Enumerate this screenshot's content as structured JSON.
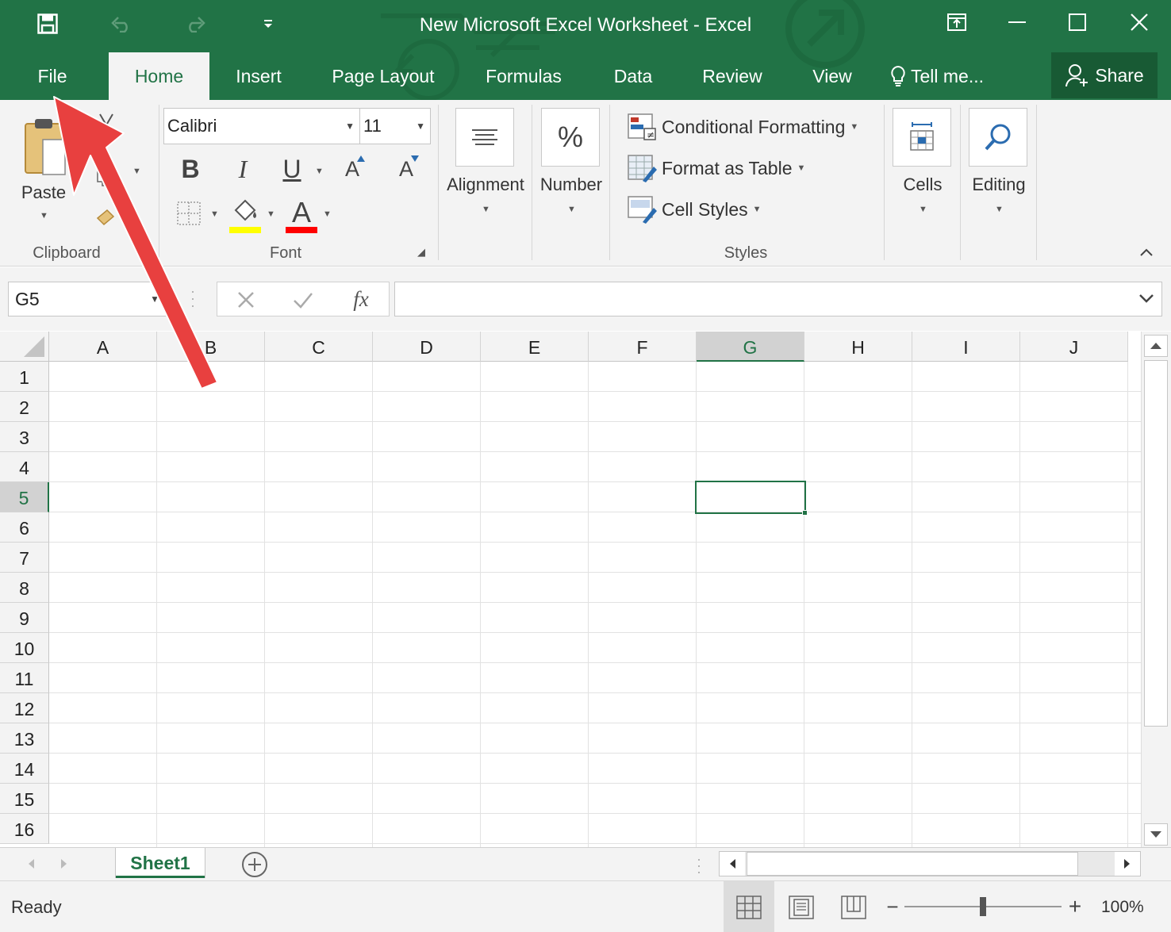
{
  "app": {
    "title": "New Microsoft Excel Worksheet - Excel",
    "accent": "#217346"
  },
  "tabs": [
    {
      "label": "File"
    },
    {
      "label": "Home",
      "active": true
    },
    {
      "label": "Insert"
    },
    {
      "label": "Page Layout"
    },
    {
      "label": "Formulas"
    },
    {
      "label": "Data"
    },
    {
      "label": "Review"
    },
    {
      "label": "View"
    }
  ],
  "tell_me": "Tell me...",
  "share_label": "Share",
  "ribbon": {
    "clipboard": {
      "paste_label": "Paste",
      "group_label": "Clipboard"
    },
    "font": {
      "name": "Calibri",
      "size": "11",
      "group_label": "Font",
      "bold": "B",
      "italic": "I",
      "underline": "U",
      "grow": "A",
      "shrink": "A",
      "font_color_glyph": "A",
      "highlight_color": "#ffff00",
      "font_color": "#ff0000"
    },
    "alignment_label": "Alignment",
    "number": {
      "glyph": "%",
      "label": "Number"
    },
    "styles": {
      "conditional": "Conditional Formatting",
      "format_table": "Format as Table",
      "cell_styles": "Cell Styles",
      "group_label": "Styles"
    },
    "cells_label": "Cells",
    "editing_label": "Editing"
  },
  "formula_bar": {
    "name_box": "G5",
    "fx": "fx",
    "value": ""
  },
  "grid": {
    "columns": [
      "A",
      "B",
      "C",
      "D",
      "E",
      "F",
      "G",
      "H",
      "I",
      "J"
    ],
    "rows": [
      "1",
      "2",
      "3",
      "4",
      "5",
      "6",
      "7",
      "8",
      "9",
      "10",
      "11",
      "12",
      "13",
      "14",
      "15",
      "16"
    ],
    "selected_column": "G",
    "selected_row": "5"
  },
  "sheets": [
    {
      "name": "Sheet1",
      "active": true
    }
  ],
  "status": {
    "ready": "Ready",
    "zoom": "100%",
    "zoom_level": 1.0
  },
  "annotation_color": "#e8403f"
}
